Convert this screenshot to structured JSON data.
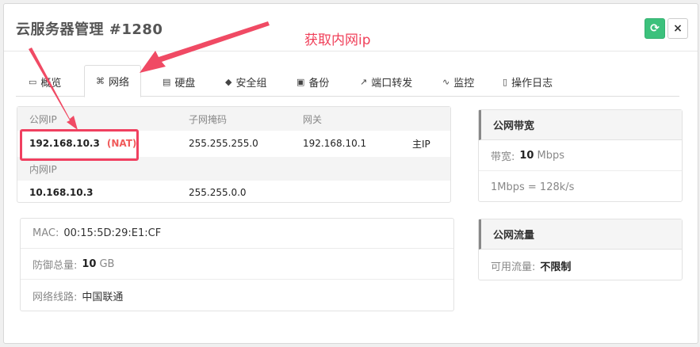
{
  "modal": {
    "title": "云服务器管理 #1280",
    "refresh_glyph": "⟳",
    "close_glyph": "×"
  },
  "annotation": "获取内网ip",
  "tabs": [
    {
      "label": "概览",
      "icon": "monitor-icon",
      "glyph": "▭"
    },
    {
      "label": "网络",
      "icon": "sitemap-icon",
      "glyph": "⌘",
      "active": true
    },
    {
      "label": "硬盘",
      "icon": "hdd-icon",
      "glyph": "▤"
    },
    {
      "label": "安全组",
      "icon": "shield-icon",
      "glyph": "◆"
    },
    {
      "label": "备份",
      "icon": "save-icon",
      "glyph": "▣"
    },
    {
      "label": "端口转发",
      "icon": "external-link-icon",
      "glyph": "↗"
    },
    {
      "label": "监控",
      "icon": "pulse-icon",
      "glyph": "∿"
    },
    {
      "label": "操作日志",
      "icon": "file-icon",
      "glyph": "▯"
    }
  ],
  "ip_table": {
    "headers": {
      "public_ip": "公网IP",
      "mask": "子网掩码",
      "gateway": "网关"
    },
    "public_row": {
      "ip": "192.168.10.3",
      "nat": "(NAT)",
      "mask": "255.255.255.0",
      "gateway": "192.168.10.1",
      "tag": "主IP"
    },
    "private_header": "内网IP",
    "private_row": {
      "ip": "10.168.10.3",
      "mask": "255.255.0.0"
    }
  },
  "info": {
    "mac_label": "MAC:",
    "mac_value": "00:15:5D:29:E1:CF",
    "defense_label": "防御总量:",
    "defense_value": "10",
    "defense_unit": "GB",
    "line_label": "网络线路:",
    "line_value": "中国联通"
  },
  "bandwidth": {
    "title": "公网带宽",
    "label": "带宽:",
    "value": "10",
    "unit": "Mbps",
    "note": "1Mbps = 128k/s"
  },
  "traffic": {
    "title": "公网流量",
    "label": "可用流量:",
    "value": "不限制"
  },
  "colors": {
    "accent_green": "#3cc17c",
    "annotation_red": "#f04060"
  }
}
